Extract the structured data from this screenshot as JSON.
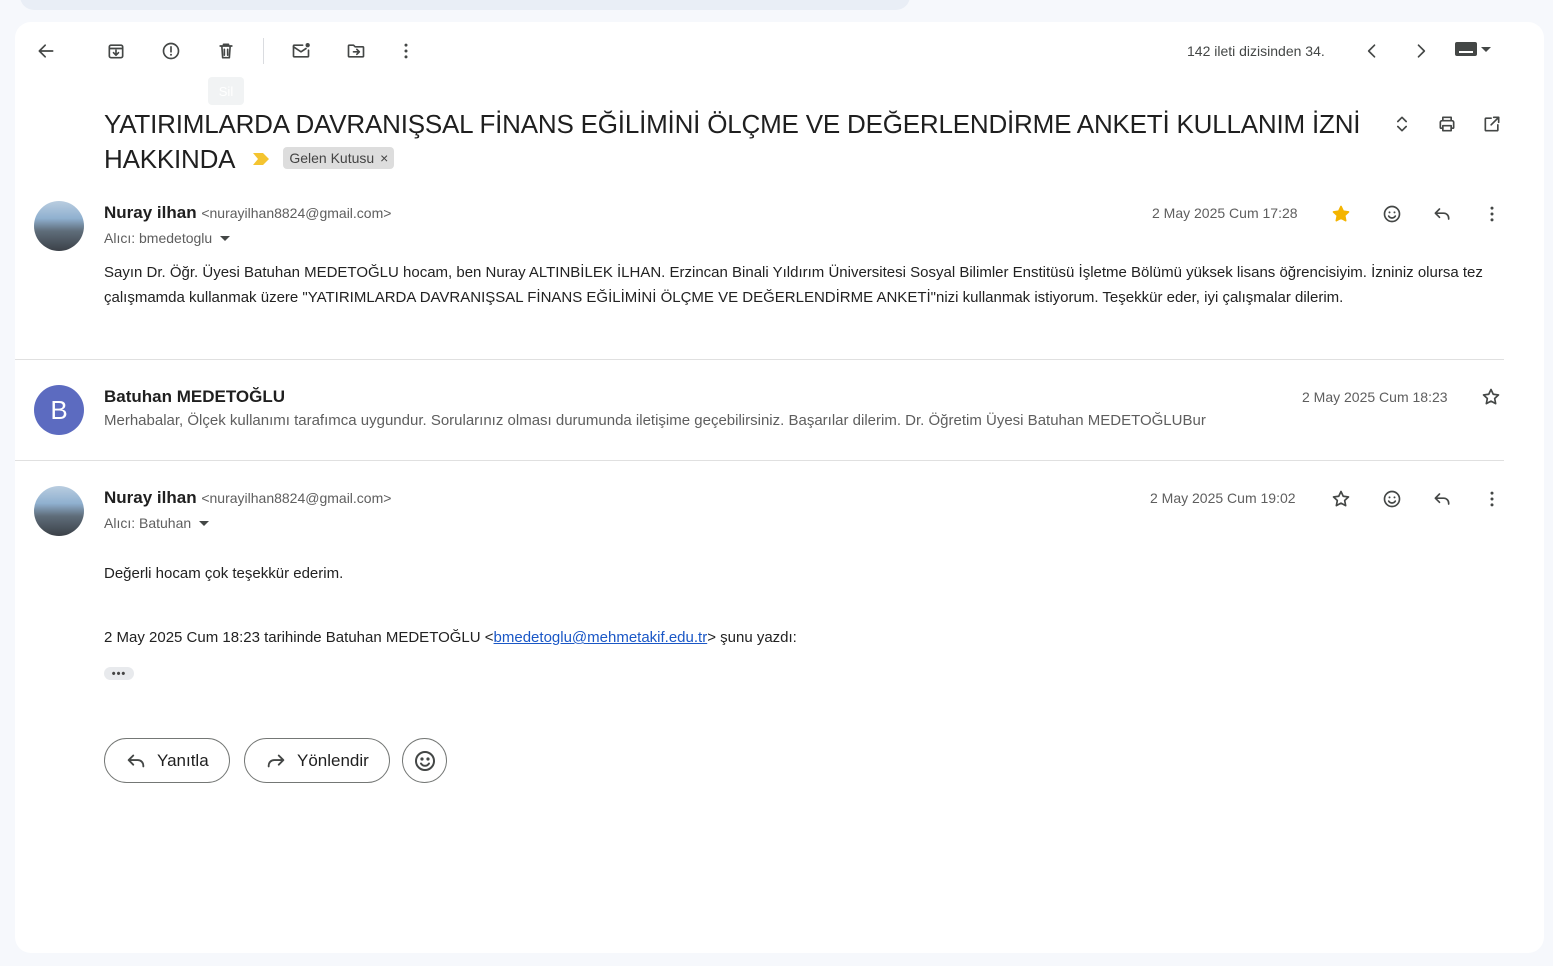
{
  "toolbar": {
    "tooltip": "Sil",
    "counter": "142 ileti dizisinden 34."
  },
  "subject": {
    "title": "YATIRIMLARDA DAVRANIŞSAL FİNANS EĞİLİMİNİ ÖLÇME VE DEĞERLENDİRME ANKETİ KULLANIM İZNİ HAKKINDA",
    "label": "Gelen Kutusu",
    "label_remove": "×"
  },
  "messages": [
    {
      "sender_name": "Nuray ilhan",
      "sender_email": "<nurayilhan8824@gmail.com>",
      "recipient": "Alıcı: bmedetoglu",
      "date": "2 May 2025 Cum 17:28",
      "starred": true,
      "body": "Sayın Dr. Öğr. Üyesi Batuhan MEDETOĞLU hocam, ben Nuray ALTINBİLEK İLHAN. Erzincan Binali Yıldırım Üniversitesi Sosyal Bilimler Enstitüsü İşletme Bölümü yüksek lisans öğrencisiyim. İzniniz olursa tez çalışmamda kullanmak üzere \"YATIRIMLARDA DAVRANIŞSAL FİNANS EĞİLİMİNİ ÖLÇME VE DEĞERLENDİRME ANKETİ\"nizi kullanmak istiyorum. Teşekkür eder, iyi çalışmalar dilerim."
    },
    {
      "avatar_letter": "B",
      "sender_name": "Batuhan MEDETOĞLU",
      "date": "2 May 2025 Cum 18:23",
      "starred": false,
      "snippet": "Merhabalar, Ölçek kullanımı tarafımca uygundur. Sorularınız olması durumunda iletişime geçebilirsiniz. Başarılar dilerim. Dr. Öğretim Üyesi Batuhan MEDETOĞLUBur"
    },
    {
      "sender_name": "Nuray ilhan",
      "sender_email": "<nurayilhan8824@gmail.com>",
      "recipient": "Alıcı: Batuhan",
      "date": "2 May 2025 Cum 19:02",
      "starred": false,
      "body": "Değerli hocam çok teşekkür ederim.",
      "quote_prefix": "2 May 2025 Cum 18:23 tarihinde Batuhan MEDETOĞLU <",
      "quote_email": "bmedetoglu@mehmetakif.edu.tr",
      "quote_suffix": "> şunu yazdı:",
      "ellipsis": "•••"
    }
  ],
  "actions": {
    "reply": "Yanıtla",
    "forward": "Yönlendir"
  },
  "colors": {
    "star_active": "#f4b400",
    "important_marker": "#f4c430",
    "link": "#1a57c6",
    "avatar_b": "#5c6bc0"
  },
  "icons": [
    "back-arrow-icon",
    "archive-icon",
    "report-spam-icon",
    "trash-icon",
    "mark-unread-icon",
    "move-to-icon",
    "more-vert-icon",
    "chevron-left-icon",
    "chevron-right-icon",
    "keyboard-icon",
    "expand-all-icon",
    "print-icon",
    "open-new-window-icon",
    "star-icon",
    "emoji-icon",
    "reply-icon",
    "forward-icon"
  ]
}
